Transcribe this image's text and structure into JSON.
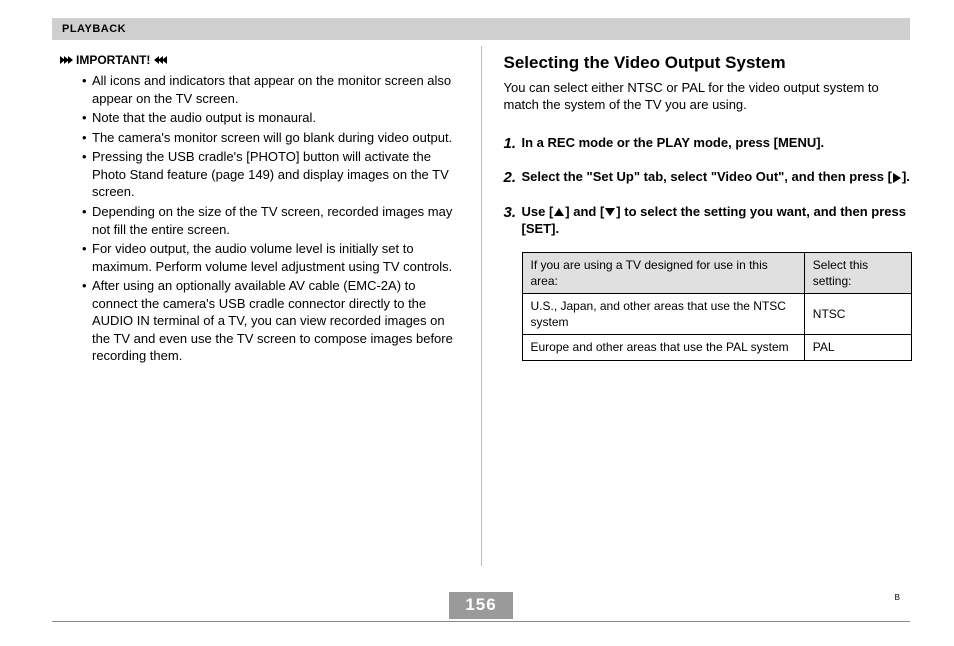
{
  "header": {
    "title": "PLAYBACK"
  },
  "left": {
    "important_label": "IMPORTANT!",
    "bullets": [
      "All icons and indicators that appear on the monitor screen also appear on the TV screen.",
      "Note that the audio output is monaural.",
      "The camera's monitor screen will go blank during video output.",
      "Pressing the USB cradle's [PHOTO] button will activate the Photo Stand feature (page 149) and display images on the TV screen.",
      "Depending on the size of the TV screen, recorded images may not fill the entire screen.",
      "For video output, the audio volume level is initially set to maximum. Perform volume level adjustment using TV controls.",
      "After using an optionally available AV cable (EMC-2A) to connect the camera's USB cradle connector directly to the AUDIO IN terminal of a TV, you can view recorded images on the TV and even use the TV screen to compose images before recording them."
    ]
  },
  "right": {
    "heading": "Selecting the Video Output System",
    "intro": "You can select either NTSC or PAL for the video output system to match the system of the TV you are using.",
    "steps": [
      {
        "n": "1",
        "text": "In a REC mode or the PLAY mode, press [MENU]."
      },
      {
        "n": "2",
        "pre": "Select the \"Set Up\" tab, select \"Video Out\", and then press [",
        "post": "]."
      },
      {
        "n": "3",
        "pre": "Use [",
        "mid": "] and [",
        "post": "] to select the setting you want, and then press [SET]."
      }
    ],
    "table": {
      "head_area": "If you are using a TV designed for use in this area:",
      "head_setting": "Select this setting:",
      "rows": [
        {
          "area": "U.S., Japan, and other areas that use the NTSC system",
          "setting": "NTSC"
        },
        {
          "area": "Europe and other areas that use the PAL system",
          "setting": "PAL"
        }
      ]
    }
  },
  "footer": {
    "page_number": "156",
    "corner": "B"
  }
}
